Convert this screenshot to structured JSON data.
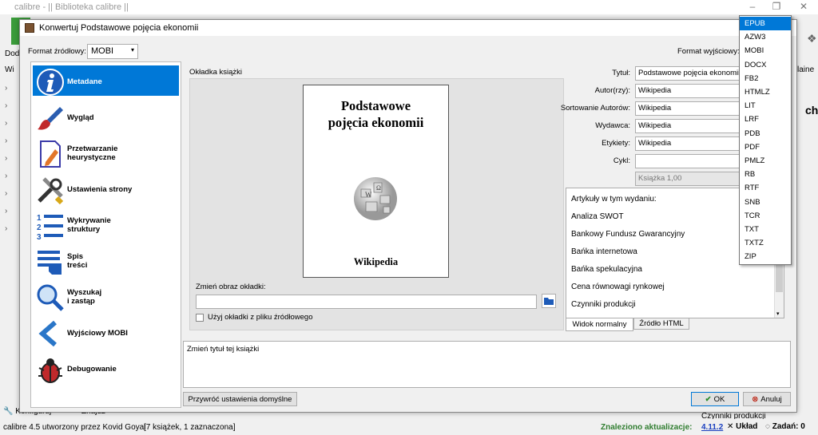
{
  "main": {
    "title": "calibre - || Biblioteka calibre ||",
    "toolbar_partial_label": "Doda",
    "toolbar_partial_label2": "Wi",
    "right_partial": "laine",
    "bottom_left_buttons": [
      "Konfiguruj",
      "Znajdź"
    ],
    "status_left": "calibre 4.5 utworzony przez Kovid Goyal",
    "status_books": "[7 książek, 1 zaznaczona]",
    "update_label": "Znaleziono aktualizacje:",
    "update_version": "4.11.2",
    "layout_label": "Układ",
    "tasks_label": "Zadań: 0",
    "partial_bottom_right": "Czynniki produkcji"
  },
  "dialog": {
    "title": "Konwertuj Podstawowe pojęcia ekonomii",
    "input_format_label": "Format źródłowy:",
    "input_format_value": "MOBI",
    "output_format_label": "Format wyjściowy:",
    "sidebar": [
      {
        "label1": "Metadane",
        "label2": "",
        "icon": "info-icon"
      },
      {
        "label1": "Wygląd",
        "label2": "",
        "icon": "paintbrush-icon"
      },
      {
        "label1": "Przetwarzanie",
        "label2": "heurystyczne",
        "icon": "document-pen-icon"
      },
      {
        "label1": "Ustawienia strony",
        "label2": "",
        "icon": "tools-icon"
      },
      {
        "label1": "Wykrywanie",
        "label2": "struktury",
        "icon": "numbered-list-icon"
      },
      {
        "label1": "Spis",
        "label2": "treści",
        "icon": "toc-icon"
      },
      {
        "label1": "Wyszukaj",
        "label2": "i zastąp",
        "icon": "magnifier-icon"
      },
      {
        "label1": "Wyjściowy MOBI",
        "label2": "",
        "icon": "chevron-left-icon"
      },
      {
        "label1": "Debugowanie",
        "label2": "",
        "icon": "bug-icon"
      }
    ],
    "cover_section_label": "Okładka książki",
    "cover_title_line1": "Podstawowe",
    "cover_title_line2": "pojęcia ekonomii",
    "cover_author": "Wikipedia",
    "change_cover_label": "Zmień obraz okładki:",
    "use_cover_checkbox": "Użyj okładki z pliku źródłowego",
    "fields": {
      "title_label": "Tytuł:",
      "title_value": "Podstawowe pojęcia ekonomii",
      "author_label": "Autor(rzy):",
      "author_value": "Wikipedia",
      "sort_label": "Sortowanie Autorów:",
      "sort_value": "Wikipedia",
      "publisher_label": "Wydawca:",
      "publisher_value": "Wikipedia",
      "tags_label": "Etykiety:",
      "tags_value": "Wikipedia",
      "series_label": "Cykl:",
      "series_value": "",
      "book_number": "Książka 1,00"
    },
    "comments": [
      "Artykuły w tym wydaniu:",
      "Analiza SWOT",
      "Bankowy Fundusz Gwarancyjny",
      "Bańka internetowa",
      "Bańka spekulacyjna",
      "Cena równowagi rynkowej",
      "Czynniki produkcji"
    ],
    "tab_normal": "Widok normalny",
    "tab_html": "Źródło HTML",
    "help_text": "Zmień tytuł tej książki",
    "restore_button": "Przywróć ustawienia domyślne",
    "ok_button": "OK",
    "cancel_button": "Anuluj"
  },
  "output_formats": [
    "EPUB",
    "AZW3",
    "MOBI",
    "DOCX",
    "FB2",
    "HTMLZ",
    "LIT",
    "LRF",
    "PDB",
    "PDF",
    "PMLZ",
    "RB",
    "RTF",
    "SNB",
    "TCR",
    "TXT",
    "TXTZ",
    "ZIP"
  ],
  "selected_output_format": "EPUB",
  "colors": {
    "accent": "#0078d7",
    "ok_green": "#2a8c2a",
    "cancel_red": "#c0392b",
    "update_green": "#2f7d2f"
  }
}
